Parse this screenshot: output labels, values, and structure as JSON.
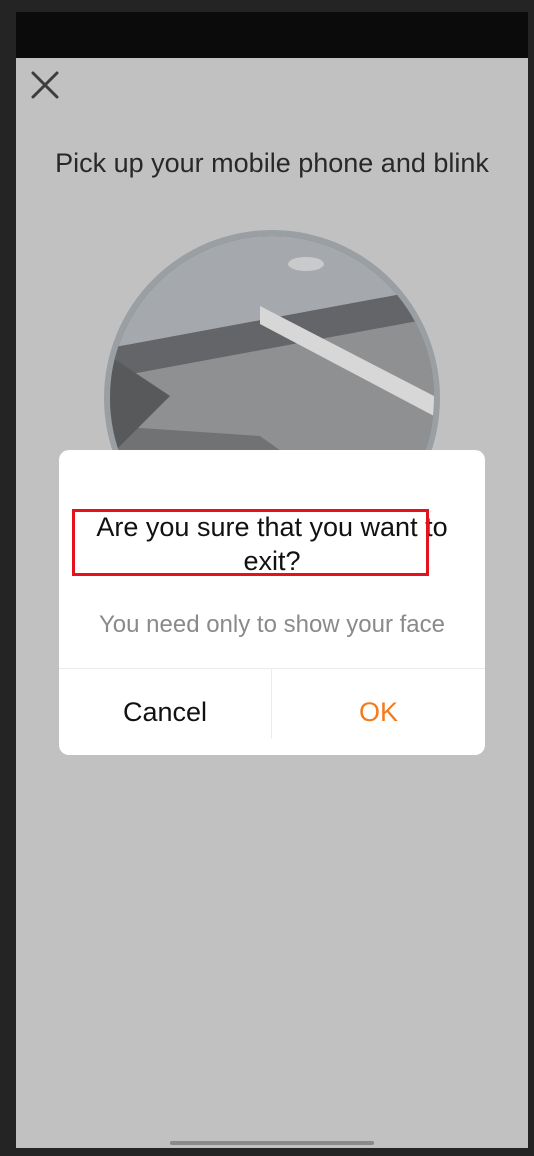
{
  "screen": {
    "title": "Pick up your mobile phone and blink"
  },
  "icons": {
    "close": "close-icon"
  },
  "dialog": {
    "title": "Are you sure that you want to exit?",
    "message": "You need only to show your face",
    "cancel_label": "Cancel",
    "ok_label": "OK"
  },
  "colors": {
    "accent": "#f47a1b",
    "screen_background": "#cbcbcb",
    "highlight": "#e3121c"
  }
}
